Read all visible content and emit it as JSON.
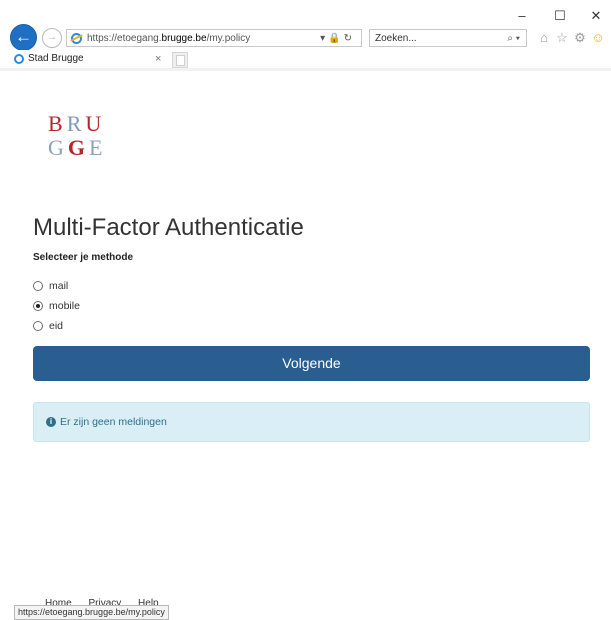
{
  "browser": {
    "address_scheme": "https://etoegang.",
    "address_domain": "brugge.be",
    "address_path": "/my.policy",
    "search_placeholder": "Zoeken...",
    "tab_title": "Stad Brugge",
    "tab_close": "×",
    "status_url": "https://etoegang.brugge.be/my.policy"
  },
  "logo": {
    "row1": [
      "B",
      "R",
      "U"
    ],
    "row2": [
      "G",
      "G",
      "E"
    ]
  },
  "page": {
    "title": "Multi-Factor Authenticatie",
    "subtitle": "Selecteer je methode",
    "options": [
      {
        "label": "mail",
        "selected": false
      },
      {
        "label": "mobile",
        "selected": true
      },
      {
        "label": "eid",
        "selected": false
      }
    ],
    "next_button": "Volgende",
    "alert_text": "Er zijn geen meldingen",
    "footer": [
      "Home",
      "Privacy",
      "Help"
    ]
  },
  "colors": {
    "primary_button": "#2a5e91",
    "alert_bg": "#d9eef5",
    "logo_red": "#b3262d"
  }
}
